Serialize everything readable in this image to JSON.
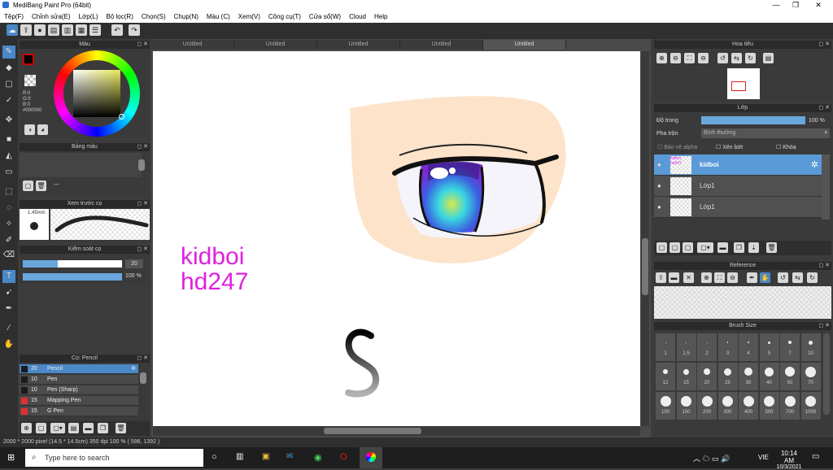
{
  "app": {
    "title": "MediBang Paint Pro (64bit)"
  },
  "menu": [
    "Tệp(F)",
    "Chỉnh sửa(E)",
    "Lớp(L)",
    "Bộ lọc(R)",
    "Chọn(S)",
    "Chụp(N)",
    "Màu (C)",
    "Xem(V)",
    "Công cụ(T)",
    "Cửa sổ(W)",
    "Cloud",
    "Help"
  ],
  "tabs": [
    "Untitled",
    "Untitled",
    "Untitled",
    "Untitled",
    "Untitled"
  ],
  "color_panel": {
    "title": "Màu",
    "rgb": [
      "R:0",
      "G:0",
      "B:0"
    ],
    "hex": "#000000",
    "fg": "#cc0000",
    "wheel_square": "#e8e85a"
  },
  "palette_panel": {
    "title": "Bảng màu",
    "dash": "---"
  },
  "brush_preview": {
    "title": "Xem trước cọ",
    "size": "1.45mm"
  },
  "brush_control": {
    "title": "Kiểm soát cọ",
    "size_value": "20",
    "opacity_value": "100 %",
    "size_fill": 0.35,
    "opacity_fill": 1.0
  },
  "brush_list": {
    "title": "Cọ: Pencil",
    "items": [
      {
        "num": "20",
        "label": "Pencil",
        "color": "#1a1a1a",
        "active": true
      },
      {
        "num": "10",
        "label": "Pen",
        "color": "#1a1a1a"
      },
      {
        "num": "10",
        "label": "Pen (Sharp)",
        "color": "#1a1a1a"
      },
      {
        "num": "15",
        "label": "Mapping Pen",
        "color": "#e03030"
      },
      {
        "num": "15",
        "label": "G Pen",
        "color": "#e03030"
      }
    ]
  },
  "canvas": {
    "text_line1": "kidboi",
    "text_line2": "hd247",
    "text_color": "#e020e0",
    "skin": "#fde3c9"
  },
  "navigator": {
    "title": "Hoa tiêu"
  },
  "layer_panel": {
    "title": "Lớp",
    "opacity_label": "Độ trong",
    "opacity_value": "100 %",
    "blend_label": "Pha trộn",
    "blend_value": "Bình thường",
    "protect_alpha": "Bảo vệ alpha",
    "clipping": "Xén bớt",
    "lock": "Khóa",
    "layers": [
      {
        "name": "kidboi",
        "thumb": "kidboi hd247",
        "active": true
      },
      {
        "name": "Lớp1"
      },
      {
        "name": "Lớp1"
      }
    ]
  },
  "reference": {
    "title": "Reference"
  },
  "brush_size": {
    "title": "Brush Size",
    "labels": [
      "1",
      "1.5",
      "2",
      "3",
      "4",
      "5",
      "7",
      "10",
      "12",
      "15",
      "20",
      "25",
      "30",
      "40",
      "50",
      "70",
      "100",
      "150",
      "200",
      "300",
      "400",
      "500",
      "700",
      "1000"
    ]
  },
  "status": {
    "text": "2000 * 2000 pixel  (14.5 * 14.5cm)  350 dpi  100 %  ( 598, 1392 )"
  },
  "taskbar": {
    "search_placeholder": "Type here to search",
    "lang": "VIE",
    "time": "10:14 AM",
    "date": "10/3/2021"
  }
}
